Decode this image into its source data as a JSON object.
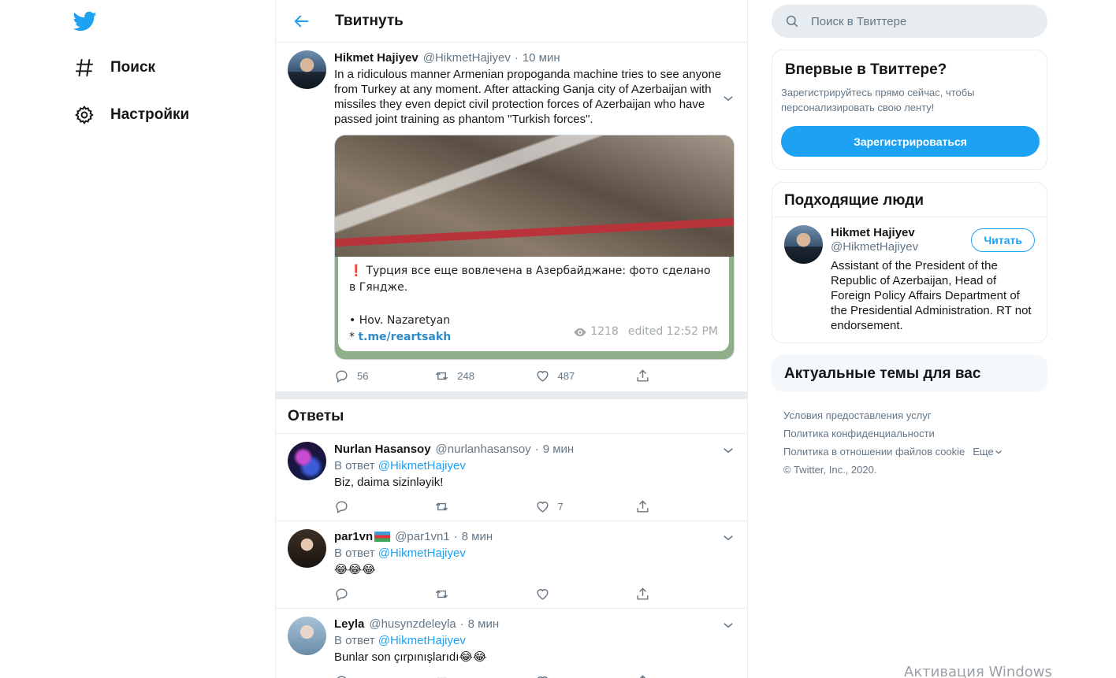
{
  "nav": {
    "items": [
      {
        "label": "Поиск",
        "icon": "hash-icon"
      },
      {
        "label": "Настройки",
        "icon": "gear-icon"
      }
    ],
    "brand_color": "#1da1f2"
  },
  "header": {
    "title": "Твитнуть"
  },
  "tweet": {
    "name": "Hikmet Hajiyev",
    "handle": "@HikmetHajiyev",
    "time": "10 мин",
    "text": "In a ridiculous manner Armenian propoganda machine tries to see anyone from Turkey at any moment. After attacking Ganja city of Azerbaijan with missiles they even depict civil protection forces of Azerbaijan who have passed joint training as phantom \"Turkish forces\".",
    "media": {
      "line1": "Турция все еще вовлечена в Азербайджане: фото сделано в Гяндже.",
      "line2": "• Hov. Nazaretyan",
      "link_prefix": "*",
      "link": "t.me/reartsakh",
      "views": "1218",
      "edited": "edited 12:52 PM"
    },
    "counts": {
      "replies": "56",
      "retweets": "248",
      "likes": "487"
    }
  },
  "replies_title": "Ответы",
  "replies": [
    {
      "name": "Nurlan Hasansoy",
      "handle": "@nurlanhasansoy",
      "time": "9 мин",
      "reply_prefix": "В ответ",
      "reply_to": "@HikmetHajiyev",
      "text": "Biz, daima sizinləyik!",
      "replies": "",
      "retweets": "",
      "likes": "7"
    },
    {
      "name": "par1vn",
      "handle": "@par1vn1",
      "time": "8 мин",
      "reply_prefix": "В ответ",
      "reply_to": "@HikmetHajiyev",
      "text": "😂😂😂",
      "replies": "",
      "retweets": "",
      "likes": ""
    },
    {
      "name": "Leyla",
      "handle": "@husynzdeleyla",
      "time": "8 мин",
      "reply_prefix": "В ответ",
      "reply_to": "@HikmetHajiyev",
      "text": "Bunlar son çırpınışlarıdı😂😂",
      "replies": "",
      "retweets": "",
      "likes": ""
    }
  ],
  "search": {
    "placeholder": "Поиск в Твиттере"
  },
  "new_card": {
    "title": "Впервые в Твиттере?",
    "subtitle": "Зарегистрируйтесь прямо сейчас, чтобы персонализировать свою ленту!",
    "button": "Зарегистрироваться"
  },
  "who_card": {
    "title": "Подходящие люди",
    "name": "Hikmet Hajiyev",
    "handle": "@HikmetHajiyev",
    "follow": "Читать",
    "bio": "Assistant of the President of the Republic of Azerbaijan, Head of Foreign Policy Affairs Department of the Presidential Administration. RT not endorsement."
  },
  "trends_card": {
    "title": "Актуальные темы для вас"
  },
  "footer": {
    "terms": "Условия предоставления услуг",
    "privacy": "Политика конфиденциальности",
    "cookies": "Политика в отношении файлов cookie",
    "more": "Еще",
    "copyright": "© Twitter, Inc., 2020."
  },
  "watermark": "Активация Windows"
}
